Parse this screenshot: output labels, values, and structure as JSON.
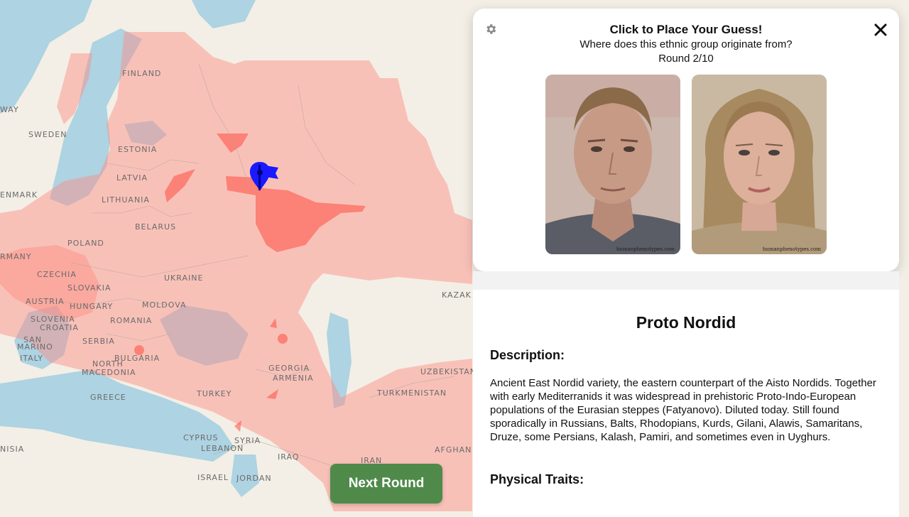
{
  "map": {
    "labels": {
      "finland": "FINLAND",
      "sweden": "SWEDEN",
      "norway": "WAY",
      "estonia": "ESTONIA",
      "latvia": "LATVIA",
      "lithuania": "LITHUANIA",
      "denmark": "ENMARK",
      "belarus": "BELARUS",
      "poland": "POLAND",
      "germany": "RMANY",
      "czechia": "CZECHIA",
      "slovakia": "SLOVAKIA",
      "ukraine": "UKRAINE",
      "austria": "AUSTRIA",
      "hungary": "HUNGARY",
      "moldova": "MOLDOVA",
      "slovenia": "SLOVENIA",
      "croatia": "CROATIA",
      "romania": "ROMANIA",
      "san_marino": "SAN",
      "san_marino2": "MARINO",
      "serbia": "SERBIA",
      "italy": "ITALY",
      "bulgaria": "BULGARIA",
      "north_macedonia": "NORTH",
      "north_macedonia2": "MACEDONIA",
      "greece": "GREECE",
      "turkey": "TURKEY",
      "georgia": "GEORGIA",
      "armenia": "ARMENIA",
      "kazakhstan": "KAZAK",
      "uzbekistan": "UZBEKISTAN",
      "turkmenistan": "TURKMENISTAN",
      "cyprus": "CYPRUS",
      "syria": "SYRIA",
      "lebanon": "LEBANON",
      "tunisia": "NISIA",
      "iraq": "IRAQ",
      "iran": "IRAN",
      "israel": "ISRAEL",
      "jordan": "JORDAN",
      "afghanistan": "AFGHAN"
    },
    "accent_color": "#ff8a80",
    "marker_color": "#1a1aff"
  },
  "card": {
    "title": "Click to Place Your Guess!",
    "subtitle": "Where does this ethnic group originate from?",
    "round": "Round 2/10",
    "watermark_left": "humanphenotypes.com",
    "watermark_right": "humanphenotypes.com"
  },
  "info": {
    "title": "Proto Nordid",
    "description_heading": "Description:",
    "description": "Ancient East Nordid variety, the eastern counterpart of the Aisto Nordids. Together with early Mediterranids it was widespread in prehistoric Proto-Indo-European populations of the Eurasian steppes (Fatyanovo). Diluted today. Still found sporadically in Russians, Balts, Rhodopians, Kurds, Gilani, Alawis, Samaritans, Druze, some Persians, Kalash, Pamiri, and sometimes even in Uyghurs.",
    "traits_heading": "Physical Traits:"
  },
  "buttons": {
    "next_round": "Next Round"
  }
}
